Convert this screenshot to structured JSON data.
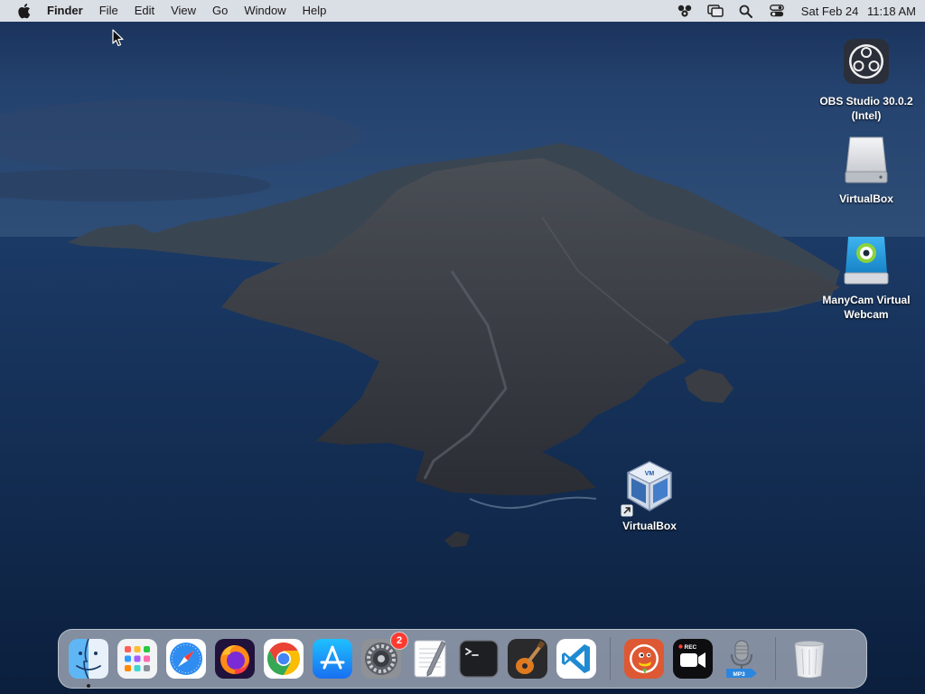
{
  "menubar": {
    "app_name": "Finder",
    "items": [
      "File",
      "Edit",
      "View",
      "Go",
      "Window",
      "Help"
    ],
    "clock_date": "Sat Feb 24",
    "clock_time": "11:18 AM",
    "status_icons": [
      "manycam-icon",
      "screen-mirroring-icon",
      "spotlight-search-icon",
      "control-center-icon"
    ]
  },
  "desktop": {
    "icons": [
      {
        "label_line1": "OBS Studio 30.0.2",
        "label_line2": "(Intel)",
        "icon": "obs-icon"
      },
      {
        "label_line1": "VirtualBox",
        "label_line2": "",
        "icon": "disk-drive-icon"
      },
      {
        "label_line1": "ManyCam Virtual",
        "label_line2": "Webcam",
        "icon": "manycam-icon"
      },
      {
        "label_line1": "VirtualBox",
        "label_line2": "",
        "icon": "virtualbox-icon"
      }
    ]
  },
  "dock": {
    "apps": [
      {
        "name": "Finder",
        "icon": "finder-icon",
        "running": true
      },
      {
        "name": "Launchpad",
        "icon": "launchpad-icon"
      },
      {
        "name": "Safari",
        "icon": "safari-icon"
      },
      {
        "name": "Firefox",
        "icon": "firefox-icon"
      },
      {
        "name": "Google Chrome",
        "icon": "chrome-icon"
      },
      {
        "name": "App Store",
        "icon": "app-store-icon"
      },
      {
        "name": "System Preferences",
        "icon": "system-preferences-icon",
        "badge": "2"
      },
      {
        "name": "TextEdit",
        "icon": "textedit-icon"
      },
      {
        "name": "Terminal",
        "icon": "terminal-icon"
      },
      {
        "name": "GarageBand",
        "icon": "garageband-icon"
      },
      {
        "name": "Visual Studio Code",
        "icon": "vscode-icon"
      },
      {
        "name": "DuckDuckGo",
        "icon": "duckduckgo-icon"
      },
      {
        "name": "Screen Recorder",
        "icon": "screen-recorder-icon",
        "overlay_text": "REC"
      },
      {
        "name": "Voice Recorder",
        "icon": "voice-recorder-icon",
        "overlay_text": "MP3"
      },
      {
        "name": "Trash",
        "icon": "trash-icon"
      }
    ]
  },
  "colors": {
    "menubar_bg": "#e9ecf0",
    "badge": "#ff3b30",
    "wallpaper_sky": "#1e3a68",
    "wallpaper_sea": "#10294d"
  }
}
